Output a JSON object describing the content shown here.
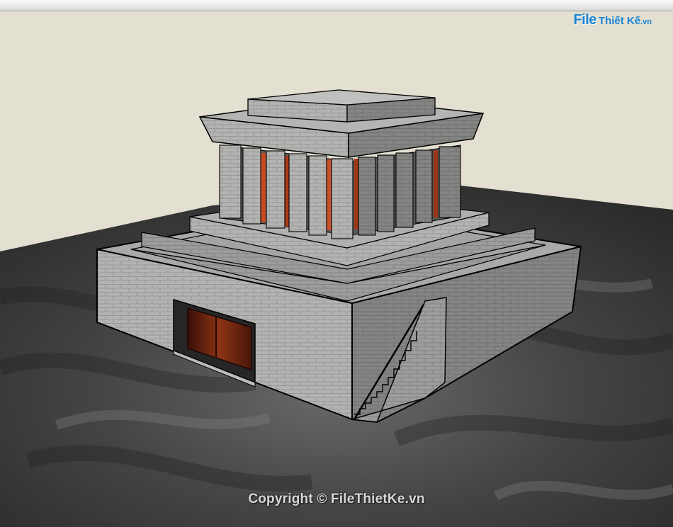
{
  "watermark": {
    "logo_prefix": "File",
    "logo_brand": "Thiết Kế",
    "logo_tld": ".vn"
  },
  "copyright": "Copyright © FileThietKe.vn",
  "scene": {
    "model": "3D mausoleum building model",
    "colors": {
      "sky": "#e3dfd1",
      "ground": "#3e3e3e",
      "stone": "#9a9a98",
      "door": "#7a2a15",
      "accent": "#c8502a"
    }
  }
}
